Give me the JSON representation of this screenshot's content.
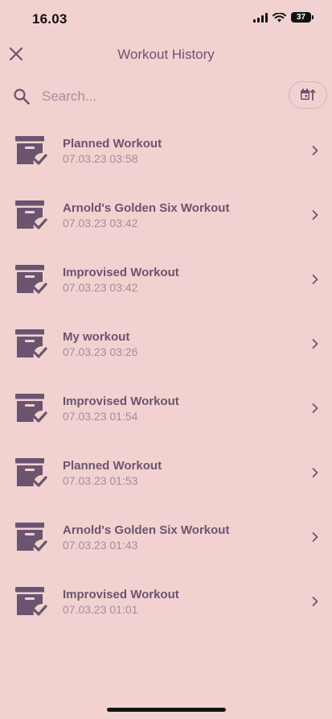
{
  "status_bar": {
    "time": "16.03",
    "battery": "37"
  },
  "header": {
    "title": "Workout History"
  },
  "search": {
    "placeholder": "Search..."
  },
  "workouts": [
    {
      "name": "Planned Workout",
      "date": "07.03.23 03:58"
    },
    {
      "name": "Arnold's Golden Six Workout",
      "date": "07.03.23 03:42"
    },
    {
      "name": "Improvised Workout",
      "date": "07.03.23 03:42"
    },
    {
      "name": "My workout",
      "date": "07.03.23 03:26"
    },
    {
      "name": "Improvised Workout",
      "date": "07.03.23 01:54"
    },
    {
      "name": "Planned Workout",
      "date": "07.03.23 01:53"
    },
    {
      "name": "Arnold's Golden Six Workout",
      "date": "07.03.23 01:43"
    },
    {
      "name": "Improvised Workout",
      "date": "07.03.23 01:01"
    }
  ],
  "icons": {
    "close": "close-icon",
    "search": "search-icon",
    "sort": "calendar-sort-icon",
    "row": "archive-check-icon",
    "chevron": "chevron-right-icon"
  },
  "colors": {
    "background": "#f2d2d0",
    "accent": "#6b5470",
    "secondary": "#a28c9c"
  }
}
